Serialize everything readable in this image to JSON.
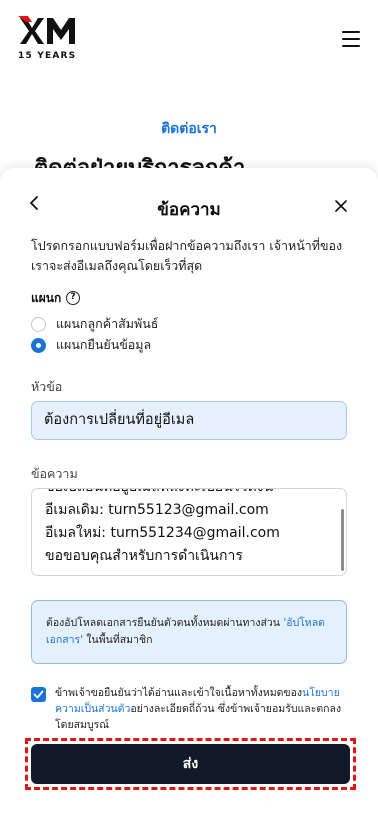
{
  "header": {
    "logo_text": "XM",
    "logo_sub": "15 YEARS",
    "menu_icon": "hamburger-icon"
  },
  "background": {
    "contact_link": "ติดต่อเรา",
    "heading": "ติดต่อฝ่ายบริการลูกค้า"
  },
  "sheet": {
    "title": "ข้อความ",
    "back_icon": "chevron-left-icon",
    "close_icon": "close-icon",
    "intro": "โปรดกรอกแบบฟอร์มเพื่อฝากข้อความถึงเรา เจ้าหน้าที่ของเราจะส่งอีเมลถึงคุณโดยเร็วที่สุด",
    "department_label": "แผนก",
    "help_icon": "?",
    "departments": [
      {
        "label": "แผนกลูกค้าสัมพันธ์",
        "selected": false
      },
      {
        "label": "แผนกยืนยันข้อมูล",
        "selected": true
      }
    ],
    "subject_label": "หัวข้อ",
    "subject_value": "ต้องการเปลี่ยนที่อยู่อีเมล",
    "message_label": "ข้อความ",
    "message_lines": [
      "ขอเปลี่ยนที่อยู่อีเมลที่ลงทะเบียนไว้ดังนี้",
      "อีเมลเดิม: turn55123@gmail.com",
      "อีเมลใหม่: turn551234@gmail.com",
      "ขอขอบคุณสำหรับการดำเนินการ"
    ],
    "info": {
      "text_before": "ต้องอัปโหลดเอกสารยืนยันตัวตนทั้งหมดผ่านทางส่วน ",
      "link": "'อัปโหลดเอกสาร'",
      "text_after": " ในพื้นที่สมาชิก"
    },
    "consent": {
      "checked": true,
      "text_before": "ข้าพเจ้าขอยืนยันว่าได้อ่านและเข้าใจเนื้อหาทั้งหมดของ",
      "link": "นโยบายความเป็นส่วนตัว",
      "text_after": "อย่างละเอียดถี่ถ้วน ซึ่งข้าพเจ้ายอมรับและตกลงโดยสมบูรณ์"
    },
    "submit_label": "ส่ง"
  },
  "colors": {
    "accent": "#1a73d9",
    "button": "#111827",
    "highlight_border": "#e01616"
  }
}
